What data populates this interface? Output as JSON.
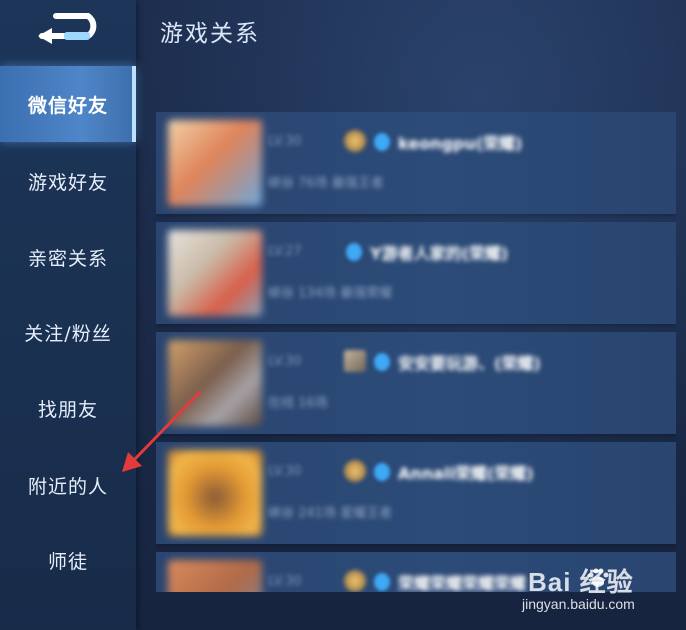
{
  "header": {
    "title": "游戏关系"
  },
  "sidebar": {
    "items": [
      {
        "label": "微信好友",
        "active": true
      },
      {
        "label": "游戏好友",
        "active": false
      },
      {
        "label": "亲密关系",
        "active": false
      },
      {
        "label": "关注/粉丝",
        "active": false
      },
      {
        "label": "找朋友",
        "active": false
      },
      {
        "label": "附近的人",
        "active": false
      },
      {
        "label": "师徒",
        "active": false
      }
    ]
  },
  "friends": [
    {
      "level": "LV.30",
      "nickname": "keongpu(荣耀)",
      "status": "峡谷 76场 最强王者"
    },
    {
      "level": "LV.27",
      "nickname": "Y游者人家的(荣耀)",
      "status": "峡谷 134场 最强荣耀"
    },
    {
      "level": "LV.30",
      "nickname": "安安要玩游、(荣耀)",
      "status": "在线 16场"
    },
    {
      "level": "LV.30",
      "nickname": "Annali荣耀(荣耀)",
      "status": "峡谷 241场 星耀王者"
    },
    {
      "level": "LV.30",
      "nickname": "荣耀荣耀荣耀荣耀",
      "status": ""
    }
  ],
  "watermark": {
    "logo": "Bai  经验",
    "url": "jingyan.baidu.com"
  },
  "colors": {
    "accent": "#4f86c9",
    "annotation": "#e23b3b",
    "card": "#2c4b78",
    "qq": "#3fa9f5"
  }
}
